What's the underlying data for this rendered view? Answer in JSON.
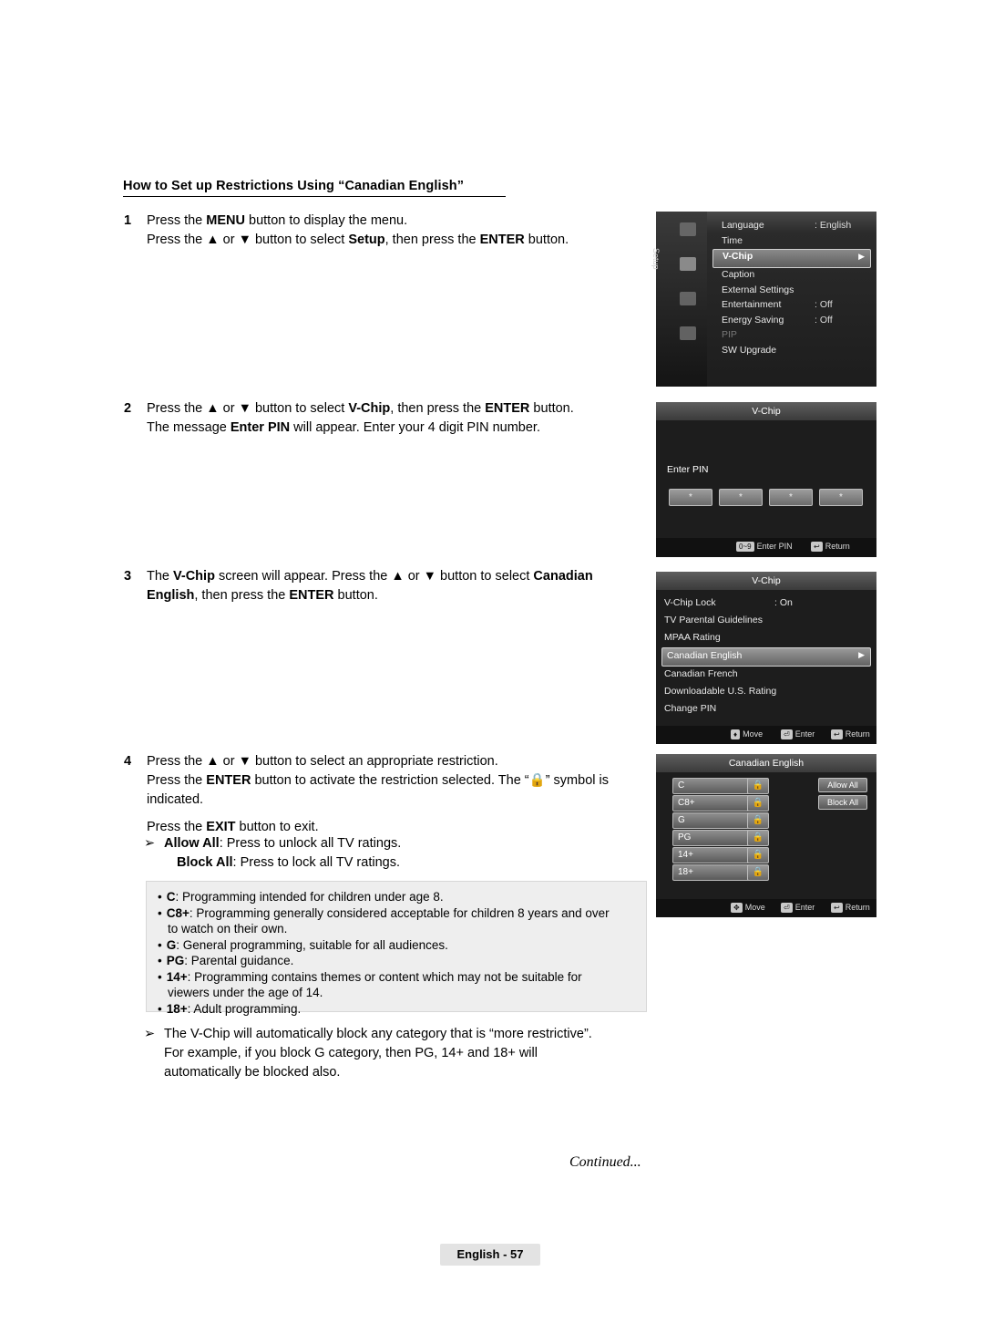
{
  "heading": "How to Set up Restrictions Using “Canadian English”",
  "steps": [
    {
      "num": "1",
      "lines": [
        [
          {
            "t": "Press the "
          },
          {
            "t": "MENU",
            "b": true
          },
          {
            "t": " button to display the menu."
          }
        ],
        [
          {
            "t": "Press the ▲ or ▼ button to select "
          },
          {
            "t": "Setup",
            "b": true
          },
          {
            "t": ", then press the "
          },
          {
            "t": "ENTER",
            "b": true
          },
          {
            "t": " button."
          }
        ]
      ]
    },
    {
      "num": "2",
      "lines": [
        [
          {
            "t": "Press the ▲ or ▼ button to select "
          },
          {
            "t": "V-Chip",
            "b": true
          },
          {
            "t": ", then press the "
          },
          {
            "t": "ENTER",
            "b": true
          },
          {
            "t": " button."
          }
        ],
        [
          {
            "t": "The message "
          },
          {
            "t": "Enter PIN",
            "b": true
          },
          {
            "t": " will appear. Enter your 4 digit PIN number."
          }
        ]
      ]
    },
    {
      "num": "3",
      "lines": [
        [
          {
            "t": "The "
          },
          {
            "t": "V-Chip",
            "b": true
          },
          {
            "t": " screen will appear. Press the ▲ or ▼ button to select "
          },
          {
            "t": "Canadian",
            "b": true
          }
        ],
        [
          {
            "t": "English",
            "b": true
          },
          {
            "t": ", then press the "
          },
          {
            "t": "ENTER",
            "b": true
          },
          {
            "t": " button."
          }
        ]
      ]
    },
    {
      "num": "4",
      "lines": [
        [
          {
            "t": "Press the ▲ or ▼ button to select an appropriate restriction."
          }
        ],
        [
          {
            "t": "Press the "
          },
          {
            "t": "ENTER",
            "b": true
          },
          {
            "t": " button to activate the restriction selected. The “🔒” symbol is"
          }
        ],
        [
          {
            "t": "indicated."
          }
        ],
        [
          {
            "t": ""
          }
        ],
        [
          {
            "t": "Press the "
          },
          {
            "t": "EXIT",
            "b": true
          },
          {
            "t": " button to exit."
          }
        ]
      ]
    }
  ],
  "bullet_arrow_1": [
    [
      {
        "t": "Allow All",
        "b": true
      },
      {
        "t": ": Press to unlock all TV ratings."
      }
    ],
    [
      {
        "t": "Block All",
        "b": true
      },
      {
        "t": ": Press to lock all TV ratings."
      }
    ]
  ],
  "notebox": [
    [
      {
        "t": "C",
        "b": true
      },
      {
        "t": ": Programming intended for children under age 8."
      }
    ],
    [
      {
        "t": "C8+",
        "b": true
      },
      {
        "t": ": Programming generally considered acceptable for children 8 years and over"
      }
    ],
    [
      {
        "t": "to watch on their own.",
        "indent": true
      }
    ],
    [
      {
        "t": "G",
        "b": true
      },
      {
        "t": ": General programming, suitable for all audiences."
      }
    ],
    [
      {
        "t": "PG",
        "b": true
      },
      {
        "t": ": Parental guidance."
      }
    ],
    [
      {
        "t": "14+",
        "b": true
      },
      {
        "t": ": Programming contains themes or content which may not be suitable for"
      }
    ],
    [
      {
        "t": "viewers under the age of 14.",
        "indent": true
      }
    ],
    [
      {
        "t": "18+",
        "b": true
      },
      {
        "t": ": Adult programming."
      }
    ]
  ],
  "bullet_arrow_2": [
    [
      {
        "t": "The V-Chip will automatically block any category that is “more restrictive”."
      }
    ],
    [
      {
        "t": "For example, if you block G category, then PG, 14+ and 18+ will"
      }
    ],
    [
      {
        "t": "automatically be blocked also."
      }
    ]
  ],
  "continued": "Continued...",
  "page_footer": "English - 57",
  "osd": {
    "setup_menu": {
      "side_label": "Setup",
      "rows": [
        {
          "label": "Language",
          "value": ": English",
          "state": "normal"
        },
        {
          "label": "Time",
          "value": "",
          "state": "normal"
        },
        {
          "label": "V-Chip",
          "value": "",
          "state": "selected",
          "arrow": "▶"
        },
        {
          "label": "Caption",
          "value": "",
          "state": "normal"
        },
        {
          "label": "External Settings",
          "value": "",
          "state": "normal"
        },
        {
          "label": "Entertainment",
          "value": ": Off",
          "state": "normal"
        },
        {
          "label": "Energy Saving",
          "value": ": Off",
          "state": "normal"
        },
        {
          "label": "PIP",
          "value": "",
          "state": "dim"
        },
        {
          "label": "SW Upgrade",
          "value": "",
          "state": "normal"
        }
      ]
    },
    "pin_panel": {
      "title": "V-Chip",
      "prompt": "Enter PIN",
      "digits": [
        "*",
        "*",
        "*",
        "*"
      ],
      "footer": [
        {
          "key": "0~9",
          "label": "Enter PIN"
        },
        {
          "key": "↩",
          "label": "Return"
        }
      ]
    },
    "vchip_panel": {
      "title": "V-Chip",
      "rows": [
        {
          "label": "V-Chip Lock",
          "value": ": On",
          "state": "normal"
        },
        {
          "label": "TV Parental Guidelines",
          "value": "",
          "state": "normal"
        },
        {
          "label": "MPAA Rating",
          "value": "",
          "state": "normal"
        },
        {
          "label": "Canadian English",
          "value": "",
          "state": "selected",
          "arrow": "▶"
        },
        {
          "label": "Canadian French",
          "value": "",
          "state": "normal"
        },
        {
          "label": "Downloadable U.S. Rating",
          "value": "",
          "state": "normal"
        },
        {
          "label": "Change PIN",
          "value": "",
          "state": "normal"
        }
      ],
      "footer": [
        {
          "key": "♦",
          "label": "Move"
        },
        {
          "key": "⏎",
          "label": "Enter"
        },
        {
          "key": "↩",
          "label": "Return"
        }
      ]
    },
    "canadian_english_panel": {
      "title": "Canadian English",
      "ratings": [
        "C",
        "C8+",
        "G",
        "PG",
        "14+",
        "18+"
      ],
      "lock_glyph": "🔒",
      "buttons": [
        {
          "label": "Allow All"
        },
        {
          "label": "Block All"
        }
      ],
      "footer": [
        {
          "key": "✥",
          "label": "Move"
        },
        {
          "key": "⏎",
          "label": "Enter"
        },
        {
          "key": "↩",
          "label": "Return"
        }
      ]
    }
  }
}
